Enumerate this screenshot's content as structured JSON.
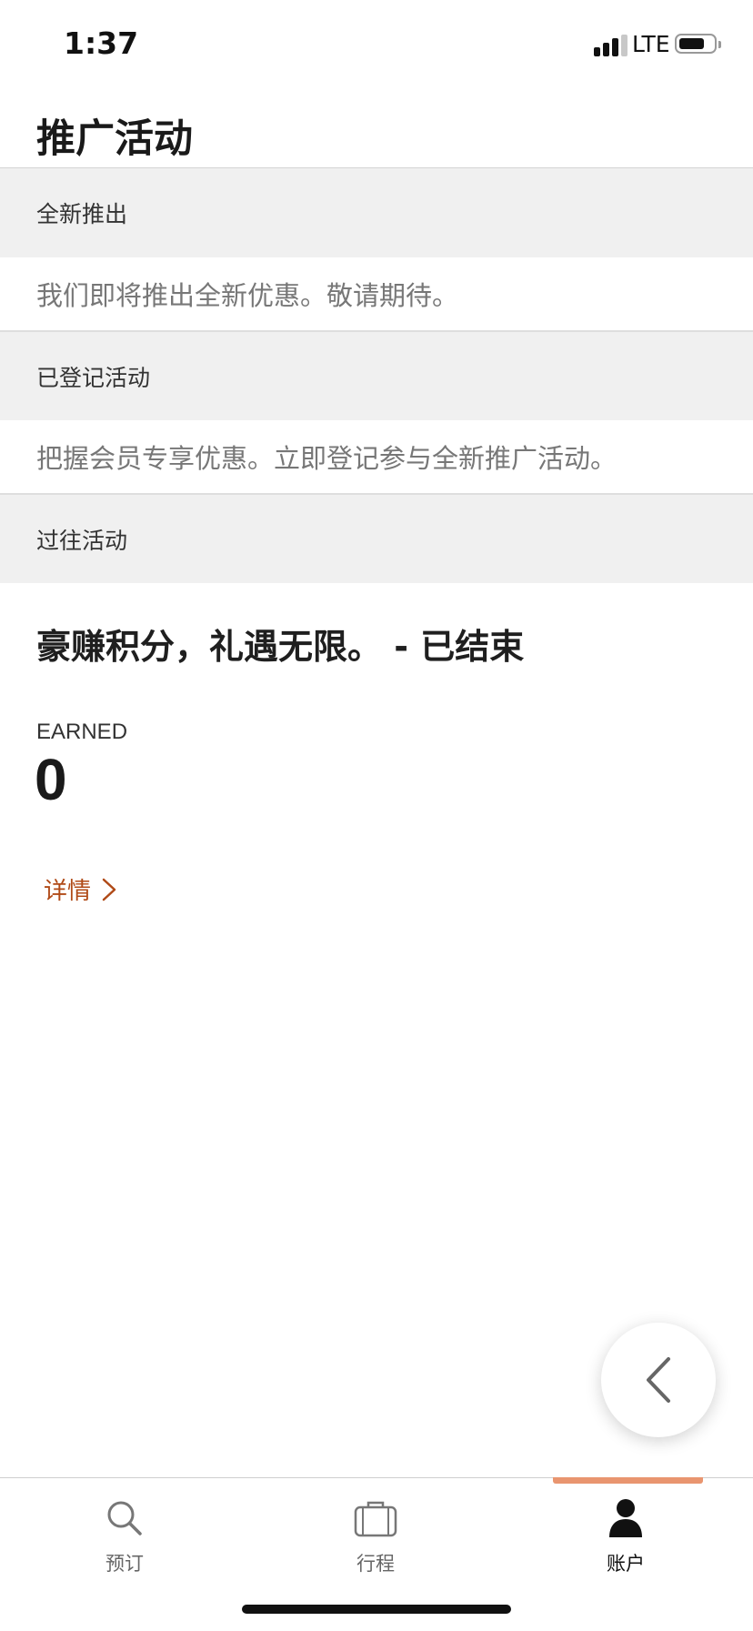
{
  "status_bar": {
    "time": "1:37",
    "network": "LTE",
    "signal_bars": 3,
    "signal_bars_max": 4,
    "battery_level": 0.75
  },
  "page": {
    "title": "推广活动"
  },
  "sections": [
    {
      "header": "全新推出",
      "body": "我们即将推出全新优惠。敬请期待。"
    },
    {
      "header": "已登记活动",
      "body": "把握会员专享优惠。立即登记参与全新推广活动。"
    },
    {
      "header": "过往活动"
    }
  ],
  "past_promotion": {
    "title": "豪赚积分，礼遇无限。 - 已结束",
    "earned_label": "EARNED",
    "earned_value": "0",
    "details_label": "详情",
    "details_icon": "chevron-right-icon"
  },
  "fab": {
    "icon": "chevron-left-icon"
  },
  "tab_bar": {
    "tabs": [
      {
        "label": "预订",
        "icon": "search-icon",
        "active": false
      },
      {
        "label": "行程",
        "icon": "briefcase-icon",
        "active": false
      },
      {
        "label": "账户",
        "icon": "person-icon",
        "active": true
      }
    ]
  },
  "colors": {
    "accent_link": "#b04a17",
    "tab_indicator": "#e9956f",
    "section_header_bg": "#f0f0f0"
  }
}
